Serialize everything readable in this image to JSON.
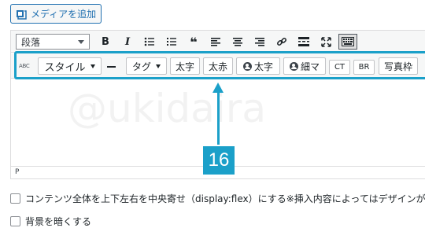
{
  "media_button": {
    "label": "メディアを追加",
    "icon": "add-media-icon"
  },
  "toolbar1": {
    "format_select": "段落",
    "icons": [
      "bold-icon",
      "italic-icon",
      "bulleted-list-icon",
      "numbered-list-icon",
      "blockquote-icon",
      "align-left-icon",
      "align-center-icon",
      "align-right-icon",
      "link-icon",
      "read-more-icon",
      "fullscreen-icon",
      "toolbar-toggle-icon"
    ]
  },
  "toolbar2": {
    "spellcheck_label": "ABC",
    "style_dropdown": "スタイル",
    "tag_dropdown": "タグ",
    "buttons": [
      "太字",
      "太赤",
      "太字",
      "細マ",
      "CT",
      "BR",
      "写真枠"
    ]
  },
  "editor": {
    "watermark": "@ukidaira",
    "status_path": "P"
  },
  "annotation": {
    "number": "16",
    "color": "#1ba0c9"
  },
  "options": [
    {
      "label": "コンテンツ全体を上下左右を中央寄せ（display:flex）にする※挿入内容によってはデザインが正常"
    },
    {
      "label": "背景を暗くする"
    }
  ]
}
